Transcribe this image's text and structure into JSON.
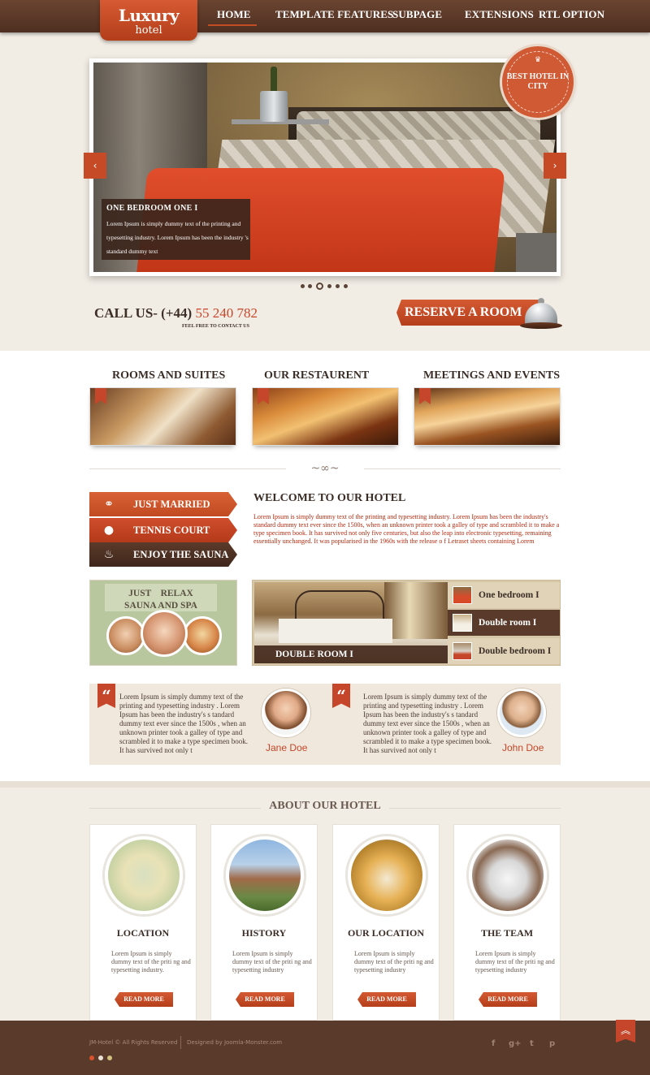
{
  "brand": {
    "logo_main": "Luxury",
    "logo_sub": "hotel"
  },
  "nav": {
    "items": [
      {
        "label": "HOME"
      },
      {
        "label": "TEMPLATE FEATURES"
      },
      {
        "label": "SUBPAGE"
      },
      {
        "label": "EXTENSIONS"
      },
      {
        "label": "RTL OPTION"
      }
    ],
    "active": "HOME"
  },
  "hero": {
    "badge": "BEST HOTEL IN CITY",
    "caption_title": "ONE BEDROOM ONE I",
    "caption_text": "Lorem Ipsum is simply dummy text of the printing and typesetting industry. Lorem Ipsum has been the industry 's standard dummy text",
    "slides_total": 6,
    "slide_active": 3
  },
  "contact": {
    "call_prefix": "CALL US- (+44)",
    "call_number": "55 240 782",
    "call_sub": "FEEL FREE TO CONTACT US",
    "reserve_label": "RESERVE A ROOM"
  },
  "sections": [
    {
      "title": "ROOMS AND SUITES"
    },
    {
      "title": "OUR RESTAURENT"
    },
    {
      "title": "MEETINGS AND EVENTS"
    }
  ],
  "tags": [
    {
      "label": "JUST MARRIED",
      "icon": "rings-icon",
      "glyph": "⚭"
    },
    {
      "label": "TENNIS COURT",
      "icon": "tennis-ball-icon",
      "glyph": "●"
    },
    {
      "label": "ENJOY THE SAUNA",
      "icon": "steam-icon",
      "glyph": "♨"
    }
  ],
  "welcome": {
    "title": "WELCOME TO OUR HOTEL",
    "text": "Lorem Ipsum is simply dummy text of the printing and typesetting industry. Lorem Ipsum has been the industry's standard dummy text ever since the 1500s, when an unknown printer took a galley of type and scrambled it to make a type specimen book. It has survived not only five centuries, but also the leap into electronic typesetting, remaining essentially unchanged. It was popularised in the 1960s with the release o f Letraset sheets containing Lorem"
  },
  "sauna": {
    "line1": "JUST    RELAX",
    "line2": "SAUNA AND SPA"
  },
  "rooms": {
    "featured_label": "DOUBLE ROOM I",
    "list": [
      {
        "label": "One bedroom I"
      },
      {
        "label": "Double room I"
      },
      {
        "label": "Double bedroom I"
      }
    ]
  },
  "testimonials": [
    {
      "text": "Lorem Ipsum is simply dummy text of the printing and typesetting industry . Lorem Ipsum has been the industry's s tandard dummy text ever since the 1500s , when an unknown printer took a galley of type and scrambled it to make a type specimen book. It has survived not only t",
      "name": "Jane Doe"
    },
    {
      "text": "Lorem Ipsum is simply dummy text of the printing and typesetting industry . Lorem Ipsum has been the industry's s tandard dummy text ever since the 1500s , when an unknown printer took a galley of type and scrambled it to make a type specimen book. It has survived not only t",
      "name": "John Doe"
    }
  ],
  "about": {
    "title": "ABOUT OUR HOTEL",
    "cards": [
      {
        "title": "LOCATION",
        "text": "Lorem Ipsum is simply dummy text of the priti ng and typesetting industry.",
        "button": "READ MORE"
      },
      {
        "title": "HISTORY",
        "text": "Lorem Ipsum is simply dummy text of the priti ng and typesetting industry",
        "button": "READ MORE"
      },
      {
        "title": "OUR LOCATION",
        "text": "Lorem Ipsum is simply dummy text of the priti ng and typesetting industry",
        "button": "READ MORE"
      },
      {
        "title": "THE TEAM",
        "text": "Lorem Ipsum is simply dummy text of the priti ng and typesetting industry",
        "button": "READ MORE"
      }
    ]
  },
  "footer": {
    "copyright": "JM-Hotel © All Rights Reserved",
    "designed_by": "Designed by Joomla-Monster.com",
    "social": [
      "f",
      "g+",
      "t",
      "p"
    ],
    "theme_dots": [
      "#d8522c",
      "#e8e0d2",
      "#d2c080"
    ]
  },
  "colors": {
    "accent": "#c5462a",
    "dark_brown": "#5a3a2a",
    "cream": "#f1ece4"
  }
}
